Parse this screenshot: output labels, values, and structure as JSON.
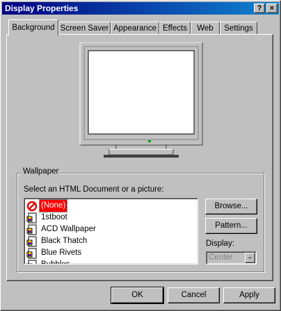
{
  "window": {
    "title": "Display Properties"
  },
  "titlebar": {
    "help": "?",
    "close": "×"
  },
  "tabs": [
    {
      "label": "Background"
    },
    {
      "label": "Screen Saver"
    },
    {
      "label": "Appearance"
    },
    {
      "label": "Effects"
    },
    {
      "label": "Web"
    },
    {
      "label": "Settings"
    }
  ],
  "wallpaper": {
    "legend": "Wallpaper",
    "prompt": "Select an HTML Document or a picture:",
    "items": [
      {
        "label": "(None)",
        "icon": "no-symbol-icon"
      },
      {
        "label": "1stboot",
        "icon": "bitmap-file-icon"
      },
      {
        "label": "ACD Wallpaper",
        "icon": "bitmap-file-icon"
      },
      {
        "label": "Black Thatch",
        "icon": "bitmap-file-icon"
      },
      {
        "label": "Blue Rivets",
        "icon": "bitmap-file-icon"
      },
      {
        "label": "Bubbles",
        "icon": "bitmap-file-icon"
      }
    ],
    "selected_index": 0,
    "browse": "Browse...",
    "pattern": "Pattern...",
    "display_label": "Display:",
    "display_value": "Center"
  },
  "footer": {
    "ok": "OK",
    "cancel": "Cancel",
    "apply": "Apply"
  },
  "colors": {
    "titlebar": "#000080",
    "face": "#c0c0c0",
    "selection": "#ff0000"
  }
}
